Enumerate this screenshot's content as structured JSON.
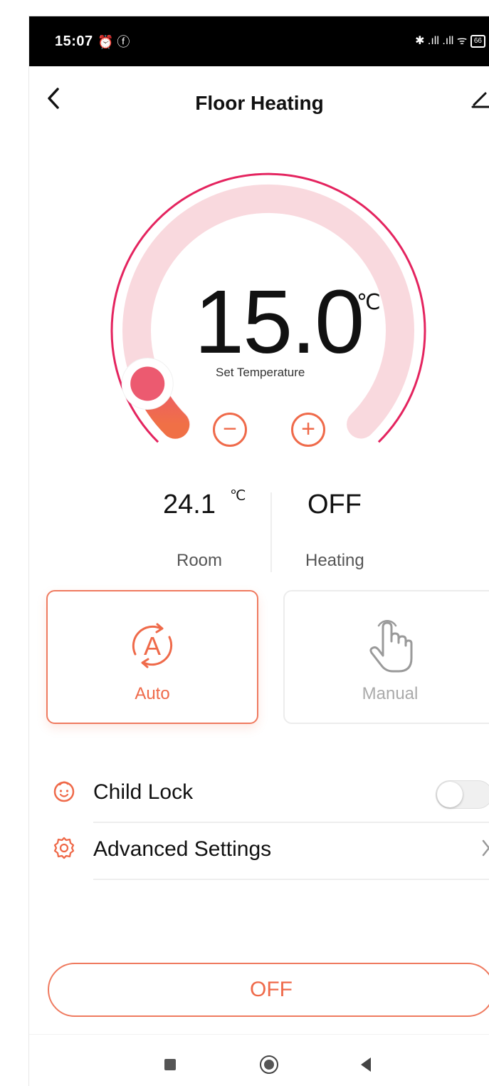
{
  "status_bar": {
    "time": "15:07",
    "left_icons": "⏰ ⓕ",
    "right_icons": "✱ .ıll .ıll ᯤ",
    "battery": "66"
  },
  "header": {
    "back_icon": "chevron-left-icon",
    "title": "Floor Heating",
    "edit_icon": "edit-icon"
  },
  "thermostat": {
    "set_temperature": "15.0",
    "unit": "℃",
    "set_label": "Set Temperature",
    "level_fraction": 0.08,
    "minus_symbol": "−",
    "plus_symbol": "+"
  },
  "stats": {
    "room_value": "24.1",
    "room_unit": "℃",
    "room_label": "Room",
    "heating_value": "OFF",
    "heating_label": "Heating"
  },
  "modes": [
    {
      "label": "Auto",
      "selected": true,
      "icon": "auto-mode-icon"
    },
    {
      "label": "Manual",
      "selected": false,
      "icon": "hand-pointer-icon"
    }
  ],
  "settings": {
    "child_lock_label": "Child Lock",
    "child_lock_on": false,
    "advanced_label": "Advanced Settings"
  },
  "power_button": "OFF",
  "colors": {
    "accent": "#ef6a4a",
    "arc_active": "#f06a5a",
    "arc_track": "#f9d9de",
    "arc_outline": "#e4245f"
  }
}
